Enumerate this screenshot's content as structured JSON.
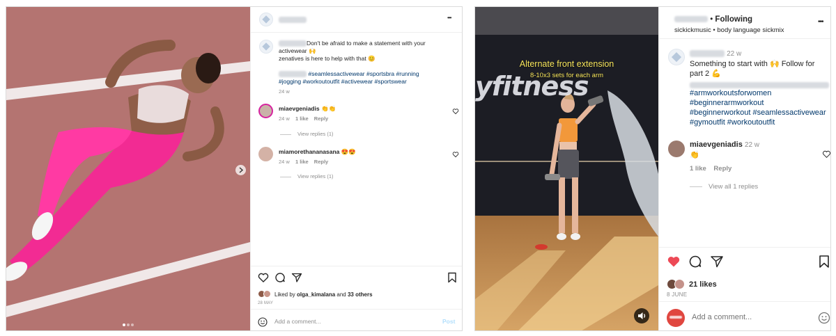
{
  "left_post": {
    "menu": "•••",
    "caption": {
      "text_line1": "Don't be afraid to make a statement with your",
      "text_line2": "activewear 🙌",
      "text_line3": "zenatives is here to help with that 😊",
      "hashtags_line1": "#seamlessactivewear #sportsbra #running",
      "hashtags_line2": "#jogging #workoutoutfit #activewear #sportswear",
      "age": "24 w"
    },
    "comments": [
      {
        "username": "miaevgeniadis",
        "text": "👏👏",
        "age": "24 w",
        "likes": "1 like",
        "reply": "Reply",
        "view_replies": "View replies (1)"
      },
      {
        "username": "miamorethananasana",
        "text": "😍😍",
        "age": "24 w",
        "likes": "1 like",
        "reply": "Reply",
        "view_replies": "View replies (1)"
      }
    ],
    "liked_by_prefix": "Liked by ",
    "liked_by_user": "olga_kimalana",
    "liked_by_and": " and ",
    "liked_by_others": "33 others",
    "date": "28 MAY",
    "comment_placeholder": "Add a comment...",
    "post_button": "Post",
    "carousel_dots": 3
  },
  "right_post": {
    "dot_sep": " • ",
    "following": "Following",
    "audio": "sickickmusic • body language sickmix",
    "menu": "•••",
    "video_title": "Alternate front extension",
    "video_subtitle": "8-10x3 sets for each arm",
    "video_wall_text": "yfitness",
    "caption": {
      "age": "22 w",
      "text_line1": "Something to start with 🙌 Follow for",
      "text_line2": "part 2 💪",
      "hashtags": [
        "#armworkoutsforwomen",
        "#beginnerarmworkout",
        "#beginnerworkout #seamlessactivewear",
        "#gymoutfit #workoutoutfit"
      ]
    },
    "comment": {
      "username": "miaevgeniadis",
      "age": "22 w",
      "text": "👏",
      "likes": "1 like",
      "reply": "Reply",
      "view_all": "View all 1 replies"
    },
    "likes": "21 likes",
    "date": "8 JUNE",
    "comment_placeholder": "Add a comment...",
    "colors": {
      "heart": "#ed4956",
      "link": "#00376b"
    }
  }
}
